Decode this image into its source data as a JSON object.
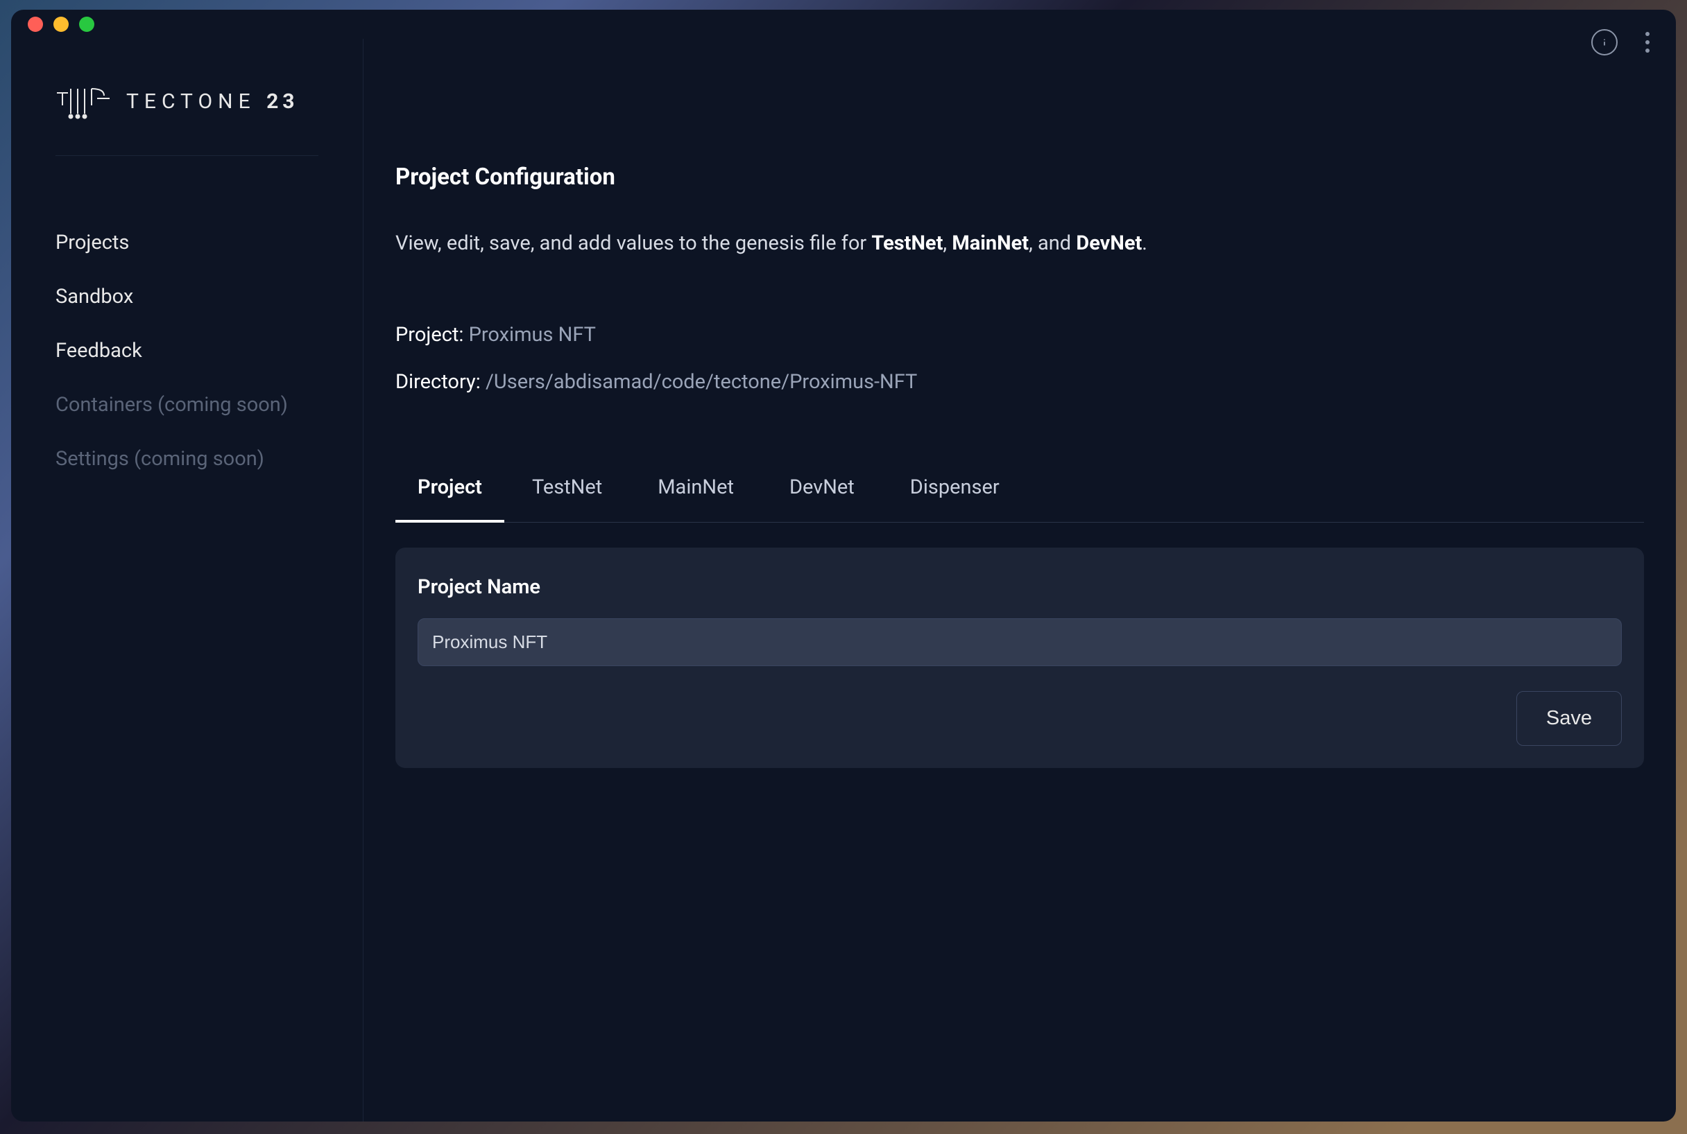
{
  "brand": {
    "name": "TECTONE",
    "suffix": "23"
  },
  "sidebar": {
    "items": [
      {
        "label": "Projects",
        "disabled": false
      },
      {
        "label": "Sandbox",
        "disabled": false
      },
      {
        "label": "Feedback",
        "disabled": false
      },
      {
        "label": "Containers (coming soon)",
        "disabled": true
      },
      {
        "label": "Settings (coming soon)",
        "disabled": true
      }
    ]
  },
  "page": {
    "title": "Project Configuration",
    "desc_prefix": "View, edit, save, and add values to the genesis file for ",
    "desc_net1": "TestNet",
    "desc_sep1": ", ",
    "desc_net2": "MainNet",
    "desc_sep2": ", and ",
    "desc_net3": "DevNet",
    "desc_suffix": "."
  },
  "meta": {
    "project_label": "Project: ",
    "project_value": "Proximus NFT",
    "directory_label": "Directory: ",
    "directory_value": "/Users/abdisamad/code/tectone/Proximus-NFT"
  },
  "tabs": [
    {
      "label": "Project",
      "active": true
    },
    {
      "label": "TestNet",
      "active": false
    },
    {
      "label": "MainNet",
      "active": false
    },
    {
      "label": "DevNet",
      "active": false
    },
    {
      "label": "Dispenser",
      "active": false
    }
  ],
  "form": {
    "name_label": "Project Name",
    "name_value": "Proximus NFT",
    "save_label": "Save"
  }
}
